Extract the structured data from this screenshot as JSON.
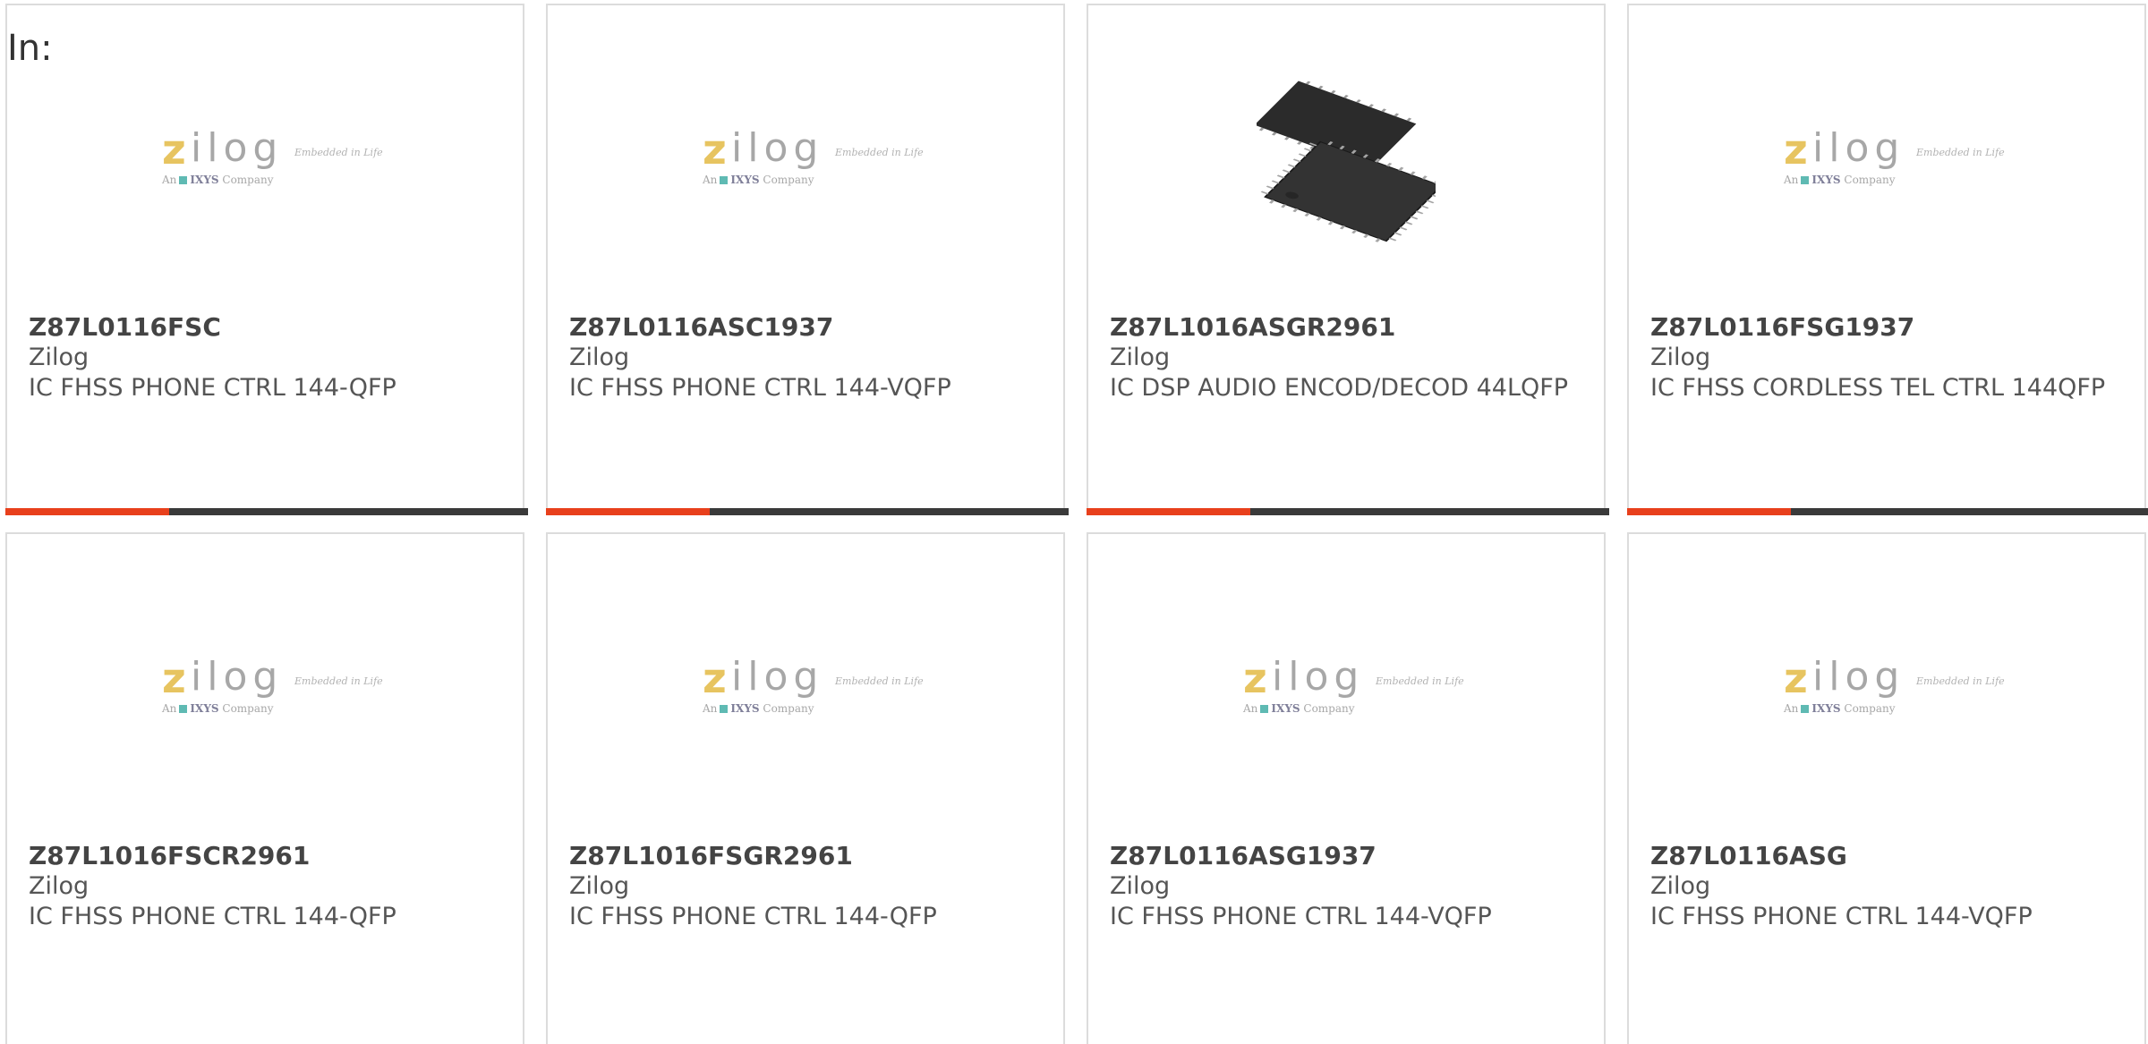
{
  "header": {
    "in_label": "In:"
  },
  "logo": {
    "brand_first": "z",
    "brand_rest": "ilog",
    "tagline": "Embedded in Life",
    "sub_prefix": "An",
    "sub_brand": "IXYS",
    "sub_suffix": "Company"
  },
  "colors": {
    "accent": "#e8401c",
    "bar": "#3a3a3a",
    "border": "#dcdcdc"
  },
  "products": [
    {
      "part": "Z87L0116FSC",
      "mfr": "Zilog",
      "desc": "IC FHSS PHONE CTRL 144-QFP",
      "image": "zilog-logo"
    },
    {
      "part": "Z87L0116ASC1937",
      "mfr": "Zilog",
      "desc": "IC FHSS PHONE CTRL 144-VQFP",
      "image": "zilog-logo"
    },
    {
      "part": "Z87L1016ASGR2961",
      "mfr": "Zilog",
      "desc": "IC DSP AUDIO ENCOD/DECOD 44LQFP",
      "image": "qfp-chip-photo"
    },
    {
      "part": "Z87L0116FSG1937",
      "mfr": "Zilog",
      "desc": "IC FHSS CORDLESS TEL CTRL 144QFP",
      "image": "zilog-logo"
    },
    {
      "part": "Z87L1016FSCR2961",
      "mfr": "Zilog",
      "desc": "IC FHSS PHONE CTRL 144-QFP",
      "image": "zilog-logo"
    },
    {
      "part": "Z87L1016FSGR2961",
      "mfr": "Zilog",
      "desc": "IC FHSS PHONE CTRL 144-QFP",
      "image": "zilog-logo"
    },
    {
      "part": "Z87L0116ASG1937",
      "mfr": "Zilog",
      "desc": "IC FHSS PHONE CTRL 144-VQFP",
      "image": "zilog-logo"
    },
    {
      "part": "Z87L0116ASG",
      "mfr": "Zilog",
      "desc": "IC FHSS PHONE CTRL 144-VQFP",
      "image": "zilog-logo"
    }
  ]
}
